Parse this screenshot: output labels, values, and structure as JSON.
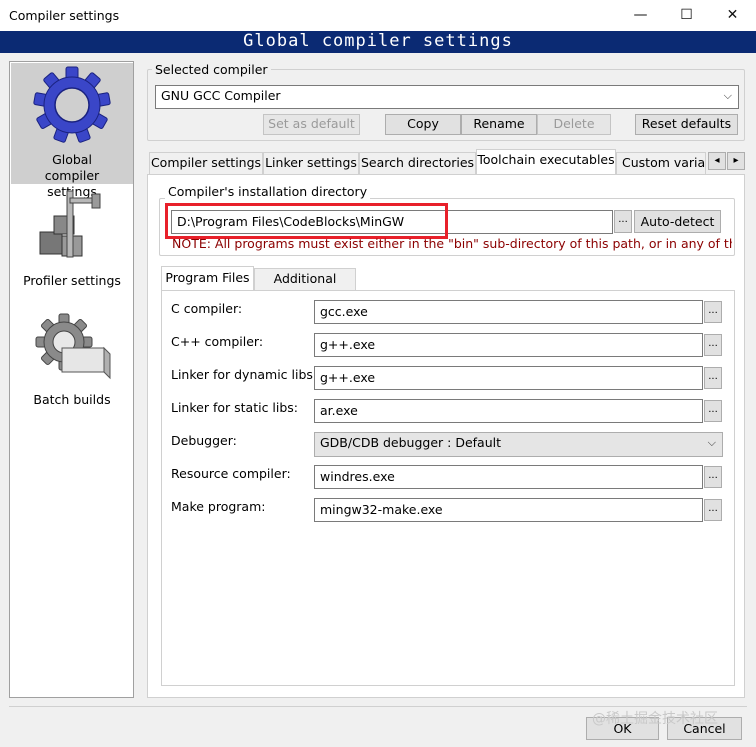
{
  "window": {
    "title": "Compiler settings",
    "minimize": "—",
    "maximize": "☐",
    "close": "✕"
  },
  "banner": "Global compiler settings",
  "sidebar": {
    "items": [
      {
        "label": "Global compiler settings",
        "icon": "gear-icon"
      },
      {
        "label": "Profiler settings",
        "icon": "caliper-icon"
      },
      {
        "label": "Batch builds",
        "icon": "batch-gear-icon"
      }
    ]
  },
  "selected_compiler": {
    "group_title": "Selected compiler",
    "value": "GNU GCC Compiler",
    "buttons": {
      "set_default": "Set as default",
      "copy": "Copy",
      "rename": "Rename",
      "delete": "Delete",
      "reset_defaults": "Reset defaults"
    }
  },
  "tabs": {
    "items": [
      "Compiler settings",
      "Linker settings",
      "Search directories",
      "Toolchain executables",
      "Custom variab"
    ],
    "active": "Toolchain executables",
    "scroll_left": "◂",
    "scroll_right": "▸"
  },
  "install_dir": {
    "group_title": "Compiler's installation directory",
    "value": "D:\\Program Files\\CodeBlocks\\MinGW",
    "browse": "...",
    "autodetect": "Auto-detect",
    "note": "NOTE: All programs must exist either in the \"bin\" sub-directory of this path, or in any of the"
  },
  "subtabs": {
    "items": [
      "Program Files",
      "Additional Paths"
    ],
    "active": "Program Files"
  },
  "programs": [
    {
      "label": "C compiler:",
      "value": "gcc.exe",
      "type": "text"
    },
    {
      "label": "C++ compiler:",
      "value": "g++.exe",
      "type": "text"
    },
    {
      "label": "Linker for dynamic libs:",
      "value": "g++.exe",
      "type": "text"
    },
    {
      "label": "Linker for static libs:",
      "value": "ar.exe",
      "type": "text"
    },
    {
      "label": "Debugger:",
      "value": "GDB/CDB debugger : Default",
      "type": "select"
    },
    {
      "label": "Resource compiler:",
      "value": "windres.exe",
      "type": "text"
    },
    {
      "label": "Make program:",
      "value": "mingw32-make.exe",
      "type": "text"
    }
  ],
  "browse_label": "...",
  "footer": {
    "ok": "OK",
    "cancel": "Cancel"
  },
  "watermark": "@稀土掘金技术社区",
  "colors": {
    "banner": "#0b2a73",
    "highlight": "#e8202a",
    "note": "#8b0000"
  }
}
